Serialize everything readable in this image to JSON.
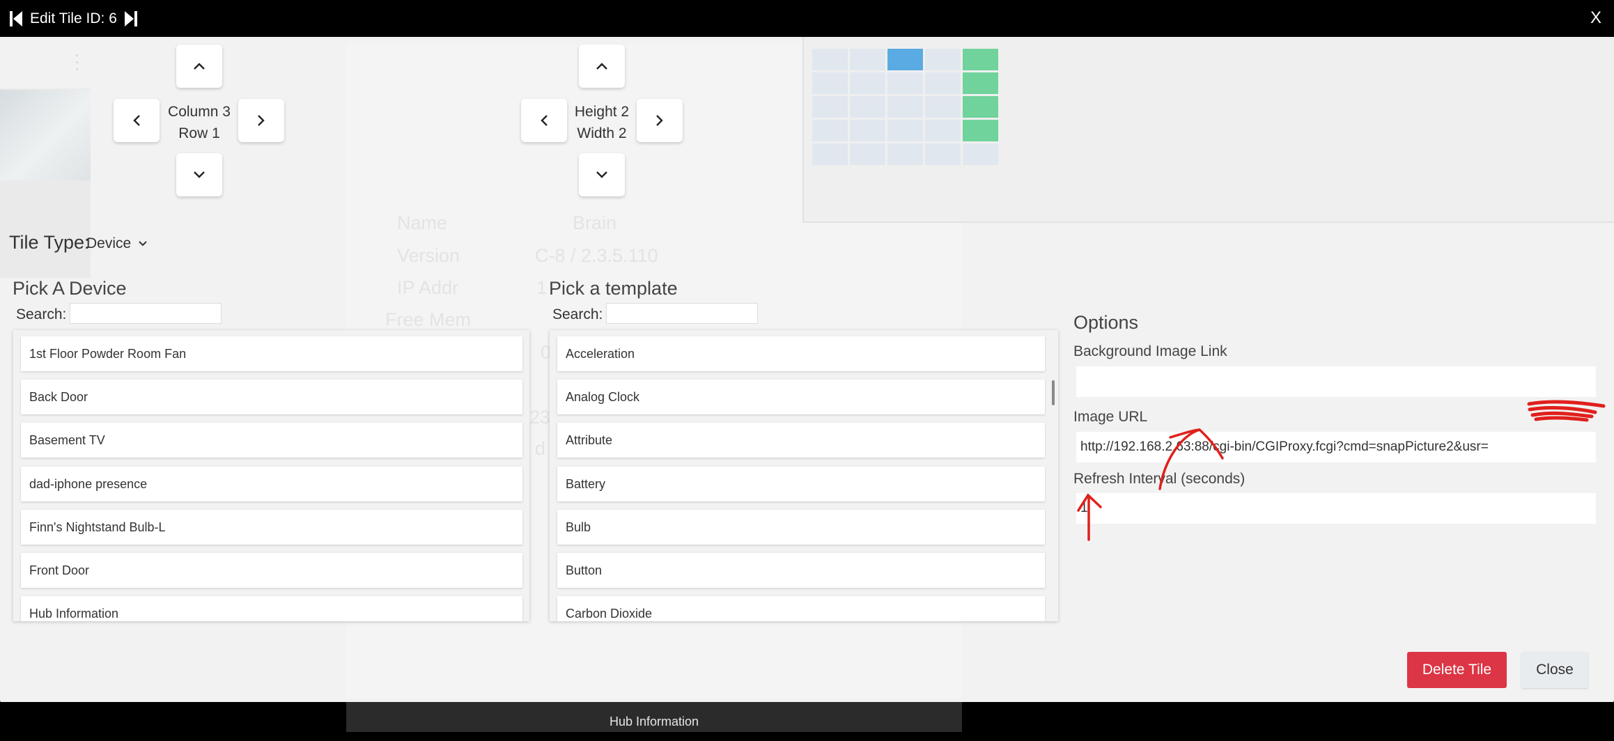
{
  "header": {
    "title": "Edit Tile ID: 6",
    "close_label": "X"
  },
  "position": {
    "column_label": "Column 3",
    "row_label": "Row 1"
  },
  "size": {
    "height_label": "Height 2",
    "width_label": "Width 2"
  },
  "background": {
    "labels": [
      "Name",
      "Version",
      "IP Addr",
      "Free Mem"
    ],
    "values": [
      "Brain",
      "C-8 / 2.3.5.110",
      "1",
      "0",
      "23",
      "d"
    ],
    "footer_tab": "Hub Information"
  },
  "tile_type": {
    "label": "Tile Type:",
    "value": "Device"
  },
  "device_picker": {
    "title": "Pick A Device",
    "search_label": "Search:",
    "search_value": "",
    "items": [
      "1st Floor Powder Room Fan",
      "Back Door",
      "Basement TV",
      "dad-iphone presence",
      "Finn's Nightstand Bulb-L",
      "Front Door",
      "Hub Information"
    ]
  },
  "template_picker": {
    "title": "Pick a template",
    "search_label": "Search:",
    "search_value": "",
    "items": [
      "Acceleration",
      "Analog Clock",
      "Attribute",
      "Battery",
      "Bulb",
      "Button",
      "Carbon Dioxide"
    ]
  },
  "options": {
    "title": "Options",
    "background_image_label": "Background Image Link",
    "background_image_value": "",
    "image_url_label": "Image URL",
    "image_url_value": "http://192.168.2.63:88/cgi-bin/CGIProxy.fcgi?cmd=snapPicture2&usr=",
    "refresh_label": "Refresh Interval (seconds)",
    "refresh_value": "1"
  },
  "footer": {
    "delete_label": "Delete Tile",
    "close_label": "Close"
  },
  "colors": {
    "delete": "#dc3545",
    "grid_selected": "#5aabe3",
    "grid_occupied": "#6fd39b",
    "annotation": "#e0201c"
  },
  "icons": {
    "prev": "skip-previous-icon",
    "next": "skip-next-icon",
    "arrows": "chevron-icon",
    "dropdown": "chevron-down-icon"
  }
}
